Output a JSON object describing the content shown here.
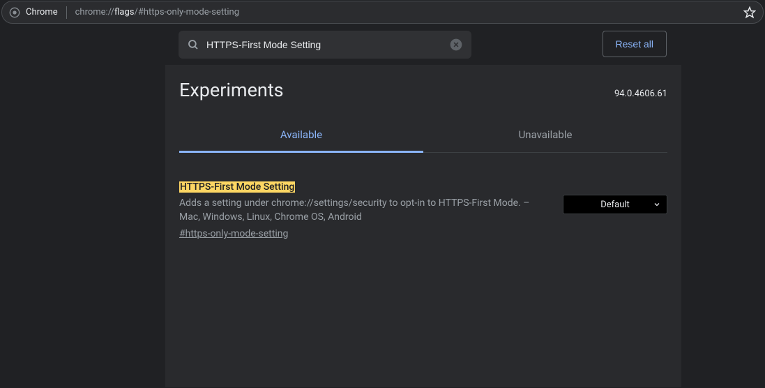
{
  "browser": {
    "app_name": "Chrome",
    "url_scheme": "chrome://",
    "url_host": "flags",
    "url_path": "/#https-only-mode-setting"
  },
  "search": {
    "value": "HTTPS-First Mode Setting"
  },
  "reset_label": "Reset all",
  "page_title": "Experiments",
  "version": "94.0.4606.61",
  "tabs": {
    "available": "Available",
    "unavailable": "Unavailable"
  },
  "flag": {
    "title": "HTTPS-First Mode Setting",
    "description": "Adds a setting under chrome://settings/security to opt-in to HTTPS-First Mode. – Mac, Windows, Linux, Chrome OS, Android",
    "anchor": "#https-only-mode-setting",
    "select_value": "Default"
  }
}
